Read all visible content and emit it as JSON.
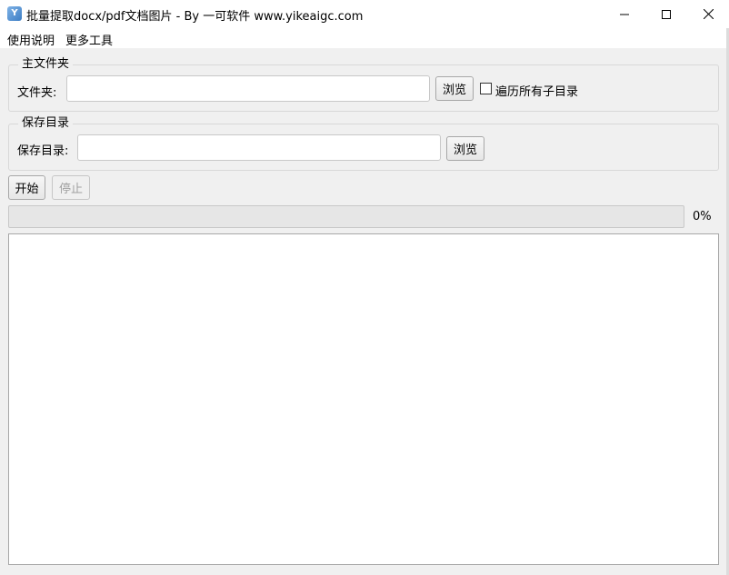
{
  "window": {
    "title": "批量提取docx/pdf文档图片 - By 一可软件 www.yikeaigc.com",
    "icon": "app-logo-icon"
  },
  "menu": {
    "items": [
      {
        "label": "使用说明"
      },
      {
        "label": "更多工具"
      }
    ]
  },
  "source_group": {
    "legend": "主文件夹",
    "label": "文件夹:",
    "value": "",
    "browse_label": "浏览",
    "recursive_label": "遍历所有子目录",
    "recursive_checked": false
  },
  "save_group": {
    "legend": "保存目录",
    "label": "保存目录:",
    "value": "",
    "browse_label": "浏览"
  },
  "actions": {
    "start_label": "开始",
    "stop_label": "停止"
  },
  "progress": {
    "value_percent": 0,
    "text": "0%"
  },
  "log": {
    "content": ""
  }
}
